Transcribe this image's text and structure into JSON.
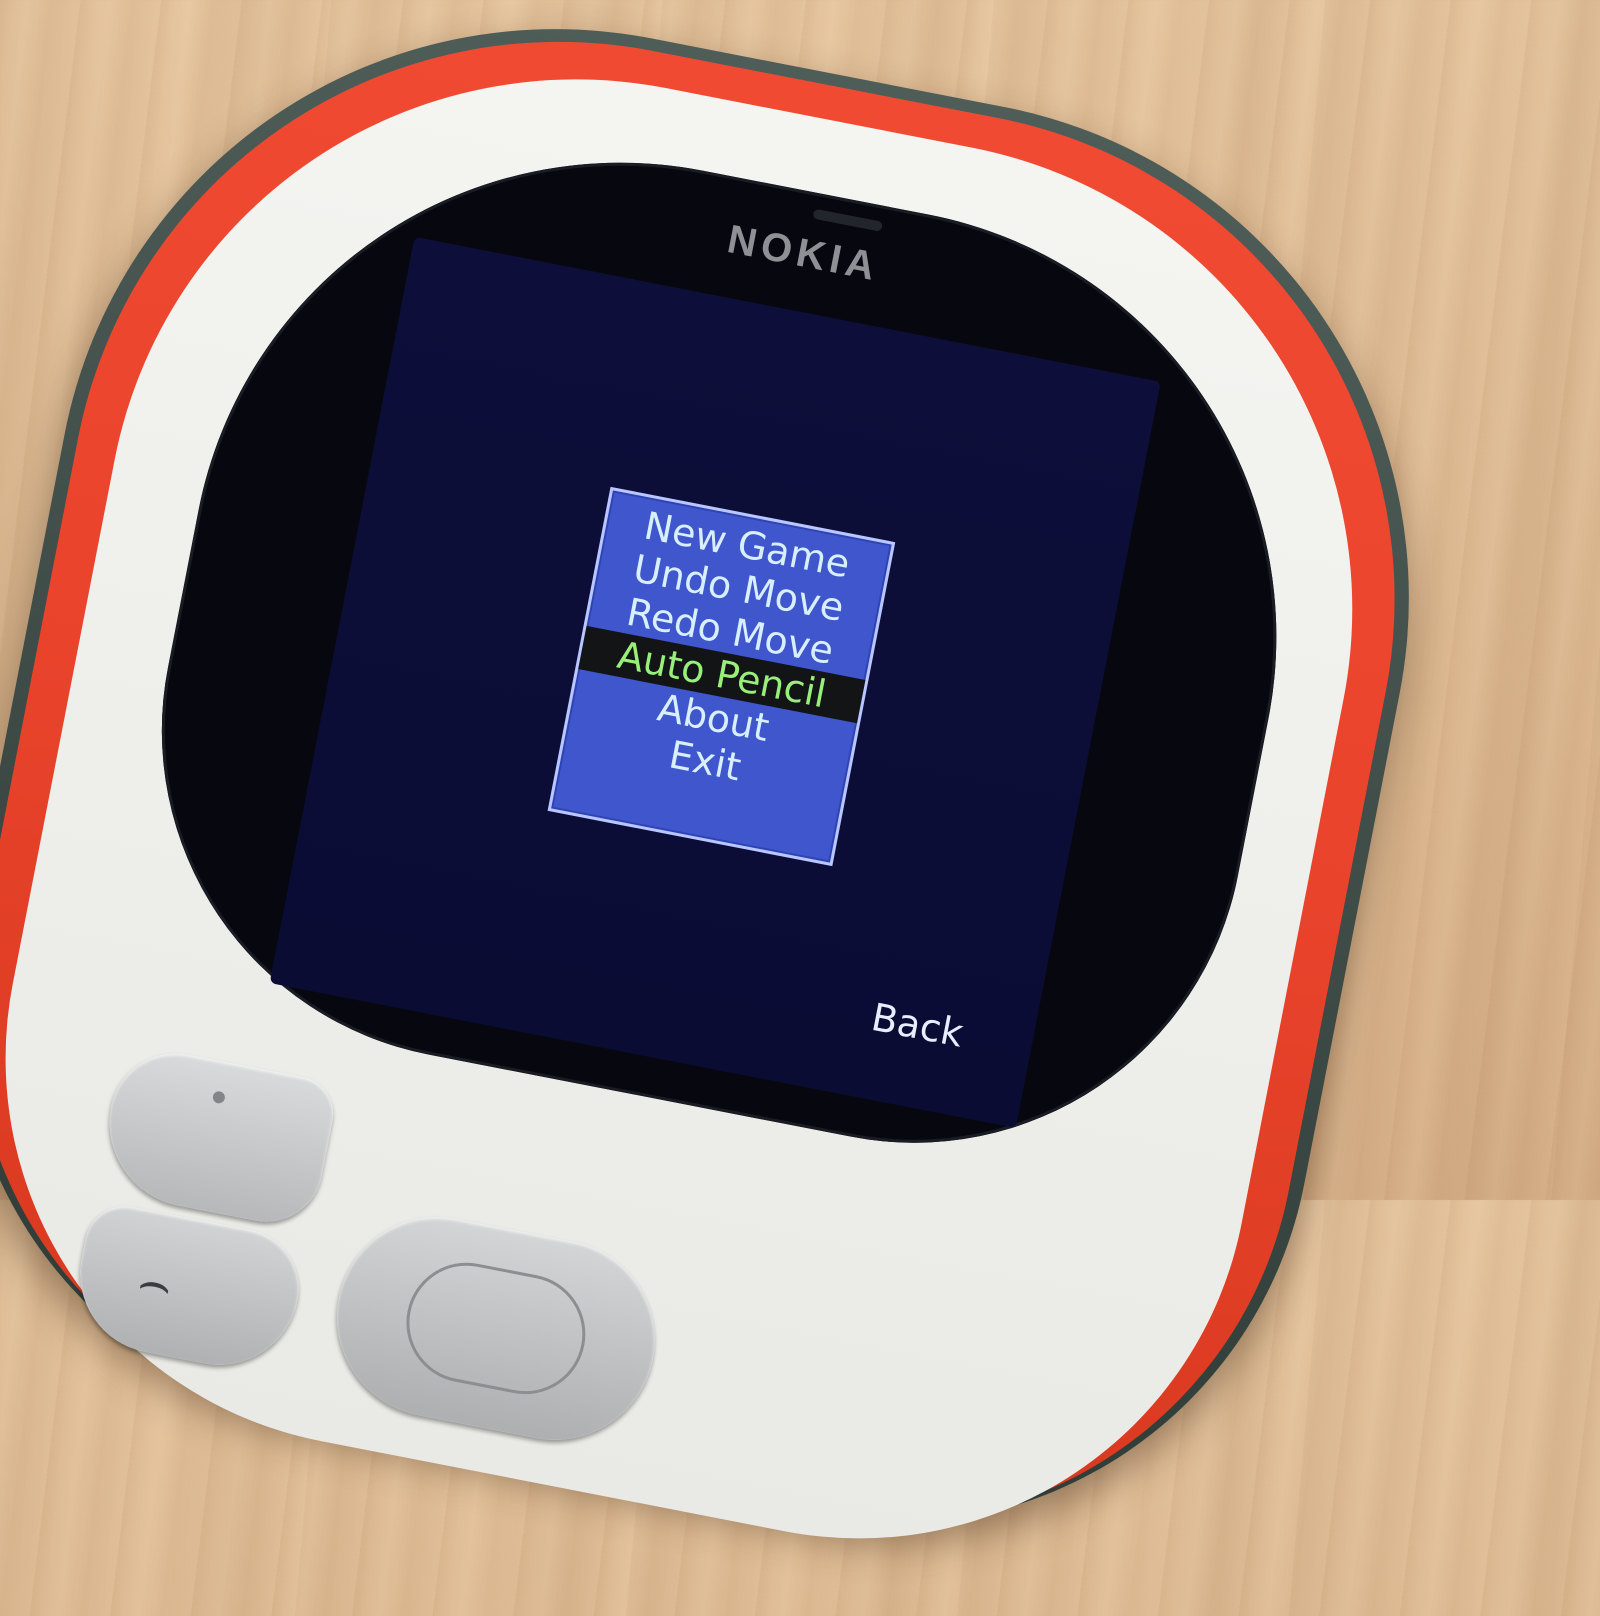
{
  "device": {
    "brand": "NOKIA"
  },
  "menu": {
    "items": [
      {
        "label": "New Game"
      },
      {
        "label": "Undo Move"
      },
      {
        "label": "Redo Move"
      },
      {
        "label": "Auto Pencil",
        "selected": true
      },
      {
        "label": "About"
      },
      {
        "label": "Exit"
      }
    ]
  },
  "softkeys": {
    "right_label": "Back"
  },
  "colors": {
    "menu_background": "#3f56cc",
    "menu_border": "#b9c6ff",
    "menu_text": "#d8efff",
    "selected_background": "#131416",
    "selected_text": "#98f07a",
    "screen_background": "#0a0c34",
    "phone_shell": "#e9432c"
  },
  "icons": {
    "call_key": "call-icon",
    "nav_key": "navigation-key",
    "left_softkey": "left-softkey"
  }
}
